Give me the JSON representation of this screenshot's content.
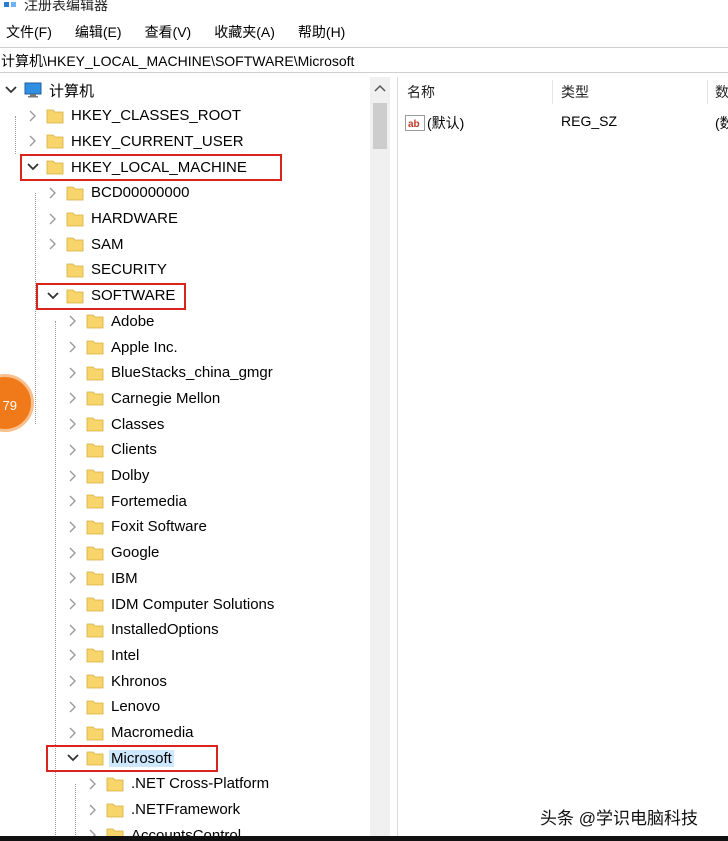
{
  "window": {
    "title": "注册表编辑器"
  },
  "menu": [
    "文件(F)",
    "编辑(E)",
    "查看(V)",
    "收藏夹(A)",
    "帮助(H)"
  ],
  "address": "计算机\\HKEY_LOCAL_MACHINE\\SOFTWARE\\Microsoft",
  "tree": {
    "root": "计算机",
    "hives": [
      "HKEY_CLASSES_ROOT",
      "HKEY_CURRENT_USER",
      "HKEY_LOCAL_MACHINE"
    ],
    "hklm_children": [
      "BCD00000000",
      "HARDWARE",
      "SAM",
      "SECURITY",
      "SOFTWARE"
    ],
    "software_children": [
      "Adobe",
      "Apple Inc.",
      "BlueStacks_china_gmgr",
      "Carnegie Mellon",
      "Classes",
      "Clients",
      "Dolby",
      "Fortemedia",
      "Foxit Software",
      "Google",
      "IBM",
      "IDM Computer Solutions",
      "InstalledOptions",
      "Intel",
      "Khronos",
      "Lenovo",
      "Macromedia",
      "Microsoft"
    ],
    "microsoft_children": [
      ".NET Cross-Platform",
      ".NETFramework",
      "AccountsControl"
    ]
  },
  "list": {
    "columns": [
      "名称",
      "类型",
      "数"
    ],
    "values": [
      {
        "name": "(默认)",
        "type": "REG_SZ",
        "data": "(数"
      }
    ]
  },
  "badge": "79",
  "watermark": "头条 @学识电脑科技",
  "colors": {
    "folder": "#f7d56b",
    "highlight": "#d9231d",
    "selected": "#cde8ff",
    "badge": "#f07a19"
  }
}
